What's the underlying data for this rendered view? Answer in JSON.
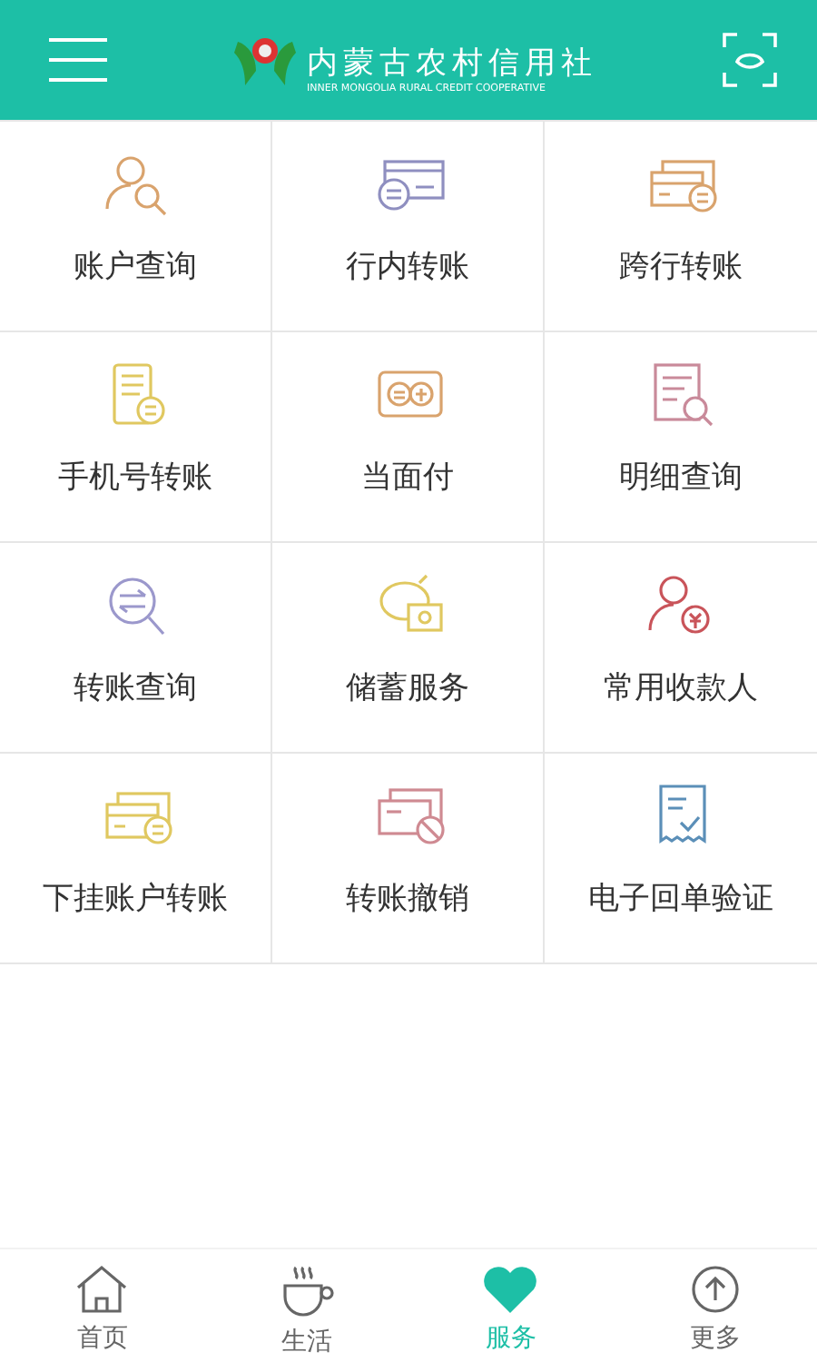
{
  "header": {
    "logo_title": "内蒙古农村信用社",
    "logo_subtitle": "INNER MONGOLIA RURAL CREDIT COOPERATIVE"
  },
  "services": [
    {
      "label": "账户查询"
    },
    {
      "label": "行内转账"
    },
    {
      "label": "跨行转账"
    },
    {
      "label": "手机号转账"
    },
    {
      "label": "当面付"
    },
    {
      "label": "明细查询"
    },
    {
      "label": "转账查询"
    },
    {
      "label": "储蓄服务"
    },
    {
      "label": "常用收款人"
    },
    {
      "label": "下挂账户转账"
    },
    {
      "label": "转账撤销"
    },
    {
      "label": "电子回单验证"
    }
  ],
  "tabs": [
    {
      "label": "首页",
      "selected": false
    },
    {
      "label": "生活",
      "selected": false
    },
    {
      "label": "服务",
      "selected": true
    },
    {
      "label": "更多",
      "selected": false
    }
  ]
}
